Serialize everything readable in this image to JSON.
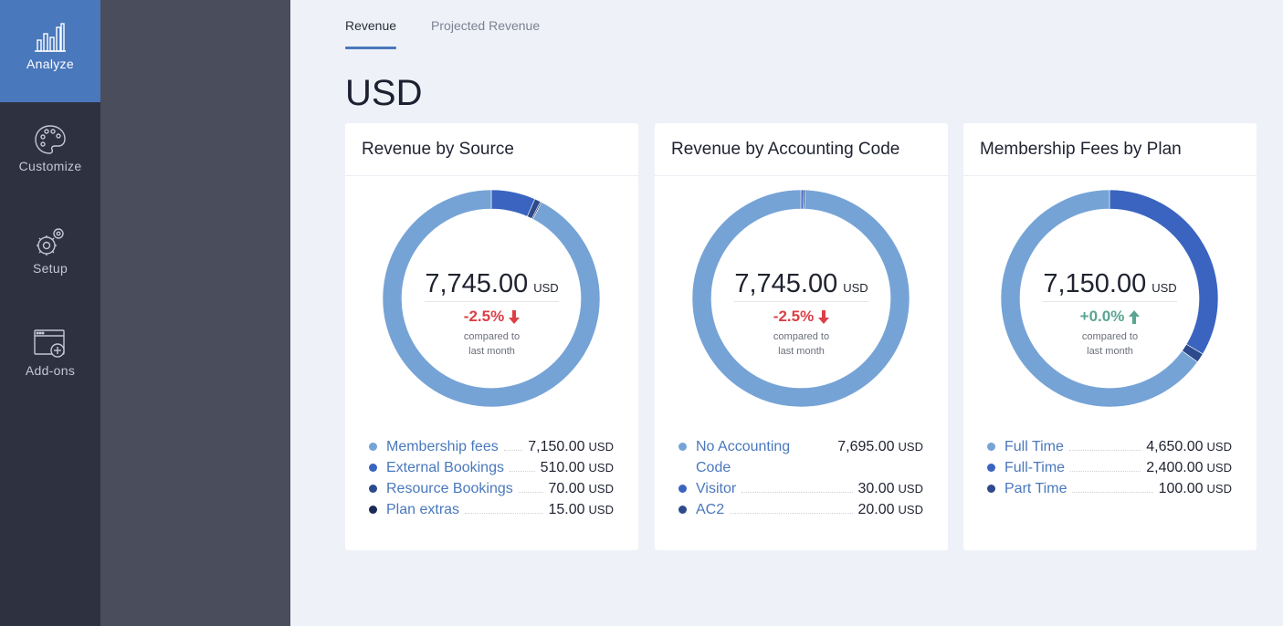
{
  "nav": {
    "items": [
      {
        "label": "Analyze",
        "icon": "bar-chart-icon",
        "active": true
      },
      {
        "label": "Customize",
        "icon": "palette-icon",
        "active": false
      },
      {
        "label": "Setup",
        "icon": "gears-icon",
        "active": false
      },
      {
        "label": "Add-ons",
        "icon": "window-plus-icon",
        "active": false
      }
    ]
  },
  "tabs": [
    {
      "label": "Revenue",
      "active": true
    },
    {
      "label": "Projected Revenue",
      "active": false
    }
  ],
  "currency_heading": "USD",
  "colors": {
    "accent": "#4a78bc",
    "series_light": "#76a3d6",
    "series_mid": "#3a64c0",
    "series_dark": "#2d4a8c",
    "series_darkest": "#1c2a55",
    "negative": "#dc3f46",
    "positive": "#5aa592"
  },
  "cards": [
    {
      "title": "Revenue by Source",
      "total": "7,745.00",
      "unit": "USD",
      "change": "-2.5%",
      "direction": "down",
      "compare_line1": "compared to",
      "compare_line2": "last month",
      "legend": [
        {
          "name": "Membership fees",
          "value": "7,150.00",
          "unit": "USD",
          "color": "#76a3d6"
        },
        {
          "name": "External Bookings",
          "value": "510.00",
          "unit": "USD",
          "color": "#3a64c0"
        },
        {
          "name": "Resource Bookings",
          "value": "70.00",
          "unit": "USD",
          "color": "#2d4a8c"
        },
        {
          "name": "Plan extras",
          "value": "15.00",
          "unit": "USD",
          "color": "#1c2a55"
        }
      ]
    },
    {
      "title": "Revenue by Accounting Code",
      "total": "7,745.00",
      "unit": "USD",
      "change": "-2.5%",
      "direction": "down",
      "compare_line1": "compared to",
      "compare_line2": "last month",
      "legend": [
        {
          "name": "No Accounting Code",
          "value": "7,695.00",
          "unit": "USD",
          "color": "#76a3d6"
        },
        {
          "name": "Visitor",
          "value": "30.00",
          "unit": "USD",
          "color": "#3a64c0"
        },
        {
          "name": "AC2",
          "value": "20.00",
          "unit": "USD",
          "color": "#2d4a8c"
        }
      ]
    },
    {
      "title": "Membership Fees by Plan",
      "total": "7,150.00",
      "unit": "USD",
      "change": "+0.0%",
      "direction": "up",
      "compare_line1": "compared to",
      "compare_line2": "last month",
      "legend": [
        {
          "name": "Full Time",
          "value": "4,650.00",
          "unit": "USD",
          "color": "#76a3d6"
        },
        {
          "name": "Full-Time",
          "value": "2,400.00",
          "unit": "USD",
          "color": "#3a64c0"
        },
        {
          "name": "Part Time",
          "value": "100.00",
          "unit": "USD",
          "color": "#2d4a8c"
        }
      ]
    }
  ],
  "chart_data": [
    {
      "type": "pie",
      "title": "Revenue by Source",
      "categories": [
        "Membership fees",
        "External Bookings",
        "Resource Bookings",
        "Plan extras"
      ],
      "values": [
        7150,
        510,
        70,
        15
      ]
    },
    {
      "type": "pie",
      "title": "Revenue by Accounting Code",
      "categories": [
        "No Accounting Code",
        "Visitor",
        "AC2"
      ],
      "values": [
        7695,
        30,
        20
      ]
    },
    {
      "type": "pie",
      "title": "Membership Fees by Plan",
      "categories": [
        "Full Time",
        "Full-Time",
        "Part Time"
      ],
      "values": [
        4650,
        2400,
        100
      ]
    }
  ]
}
